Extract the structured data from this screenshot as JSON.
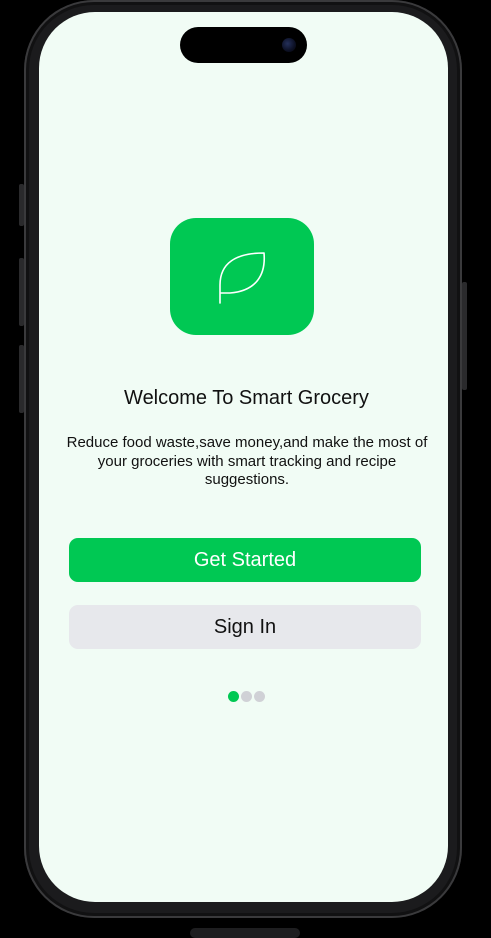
{
  "welcome": {
    "title": "Welcome To Smart Grocery",
    "subtitle": "Reduce food waste,save money,and make the most of your groceries with smart tracking and recipe suggestions."
  },
  "actions": {
    "primary_label": "Get Started",
    "secondary_label": "Sign In"
  },
  "pagination": {
    "total_pages": 3,
    "active_page": 1
  },
  "app_icon": {
    "icon": "leaf-icon",
    "background_color": "#00c853"
  },
  "colors": {
    "accent": "#00c853",
    "screen_background": "#f1fcf5",
    "secondary_button": "#e7e8ec",
    "inactive_dot": "#d0d1d6"
  }
}
